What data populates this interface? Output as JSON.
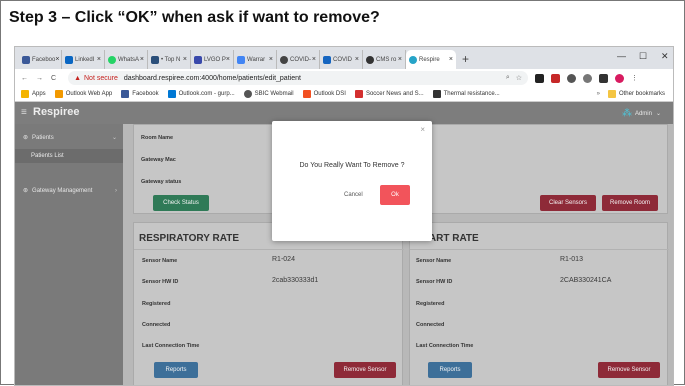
{
  "step": {
    "title": "Step 3 – Click “OK” when ask if want to remove?"
  },
  "browser": {
    "tabs": [
      {
        "label": "Faceboo",
        "color": "#3b5998"
      },
      {
        "label": "LinkedI",
        "color": "#0a66c2"
      },
      {
        "label": "WhatsA",
        "color": "#25d366"
      },
      {
        "label": "• Top N",
        "color": "#2b4f7a"
      },
      {
        "label": "LVGO P",
        "color": "#3949ab"
      },
      {
        "label": "Warrar",
        "color": "#4285f4"
      },
      {
        "label": "COVID-",
        "color": "#444444"
      },
      {
        "label": "COVID",
        "color": "#1565c0"
      },
      {
        "label": "CMS ro",
        "color": "#333333"
      },
      {
        "label": "Respire",
        "color": "#26a4c8"
      }
    ],
    "new_tab": "+",
    "window_controls": {
      "minimize": "—",
      "maximize": "☐",
      "close": "✕"
    },
    "nav": {
      "back": "←",
      "forward": "→",
      "reload": "C"
    },
    "warning_glyph": "▲",
    "security_text": "Not secure",
    "url": "dashboard.respiree.com:4000/home/patients/edit_patient",
    "bookmarks": [
      {
        "label": "Apps",
        "color": "#f4b400"
      },
      {
        "label": "Outlook Web App",
        "color": "#f29900"
      },
      {
        "label": "Facebook",
        "color": "#3b5998"
      },
      {
        "label": "Outlook.com - gurp...",
        "color": "#0078d4"
      },
      {
        "label": "SBIC Webmail",
        "color": "#555555"
      },
      {
        "label": "Outlook DSI",
        "color": "#f25022"
      },
      {
        "label": "Soccer News and S...",
        "color": "#d32f2f"
      },
      {
        "label": "Thermal resistance...",
        "color": "#333333"
      }
    ],
    "bookmarks_more": "»",
    "other_bookmarks": "Other bookmarks"
  },
  "app": {
    "brand": "Respiree",
    "admin": "Admin",
    "sidebar": {
      "patients": "Patients",
      "patients_list": "Patients List",
      "gateway": "Gateway Management"
    },
    "gateway_card": {
      "room_name": "Room Name",
      "gateway_mac": "Gateway Mac",
      "gateway_status": "Gateway status",
      "check_status": "Check Status",
      "clear_sensors": "Clear Sensors",
      "remove_room": "Remove Room"
    },
    "respiratory": {
      "title": "RESPIRATORY RATE",
      "sensor_name_label": "Sensor Name",
      "sensor_name": "R1-024",
      "hw_id_label": "Sensor HW ID",
      "hw_id": "2cab330333d1",
      "registered": "Registered",
      "connected": "Connected",
      "last_conn": "Last Connection Time",
      "reset_btn": "Reports",
      "remove_btn": "Remove Sensor"
    },
    "heart": {
      "title": "HEART RATE",
      "sensor_name_label": "Sensor Name",
      "sensor_name": "R1-013",
      "hw_id_label": "Sensor HW ID",
      "hw_id": "2CAB330241CA",
      "registered": "Registered",
      "connected": "Connected",
      "last_conn": "Last Connection Time",
      "reset_btn": "Reports",
      "remove_btn": "Remove Sensor"
    }
  },
  "modal": {
    "close": "×",
    "message": "Do You Really Want To Remove ?",
    "cancel": "Cancel",
    "ok": "Ok"
  }
}
